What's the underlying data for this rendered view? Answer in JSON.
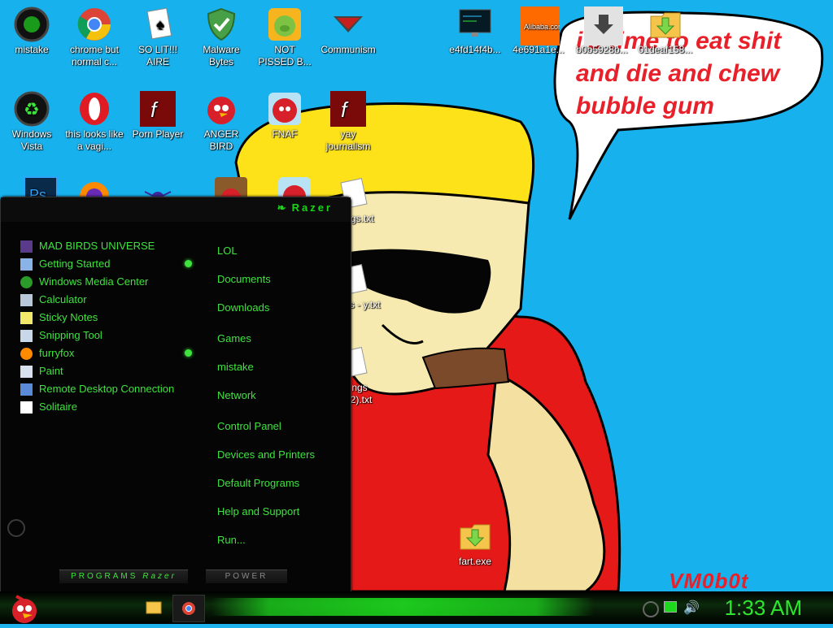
{
  "desktop": {
    "icons": [
      {
        "label": "mistake",
        "icon": "razer-black-icon"
      },
      {
        "label": "chrome but normal c...",
        "icon": "chrome-icon"
      },
      {
        "label": "SO LIT!!! AIRE",
        "icon": "playing-card-icon"
      },
      {
        "label": "Malware Bytes",
        "icon": "shield-check-icon"
      },
      {
        "label": "NOT PISSED B...",
        "icon": "angry-pig-icon"
      },
      {
        "label": "Communism",
        "icon": "red-emblem-icon"
      },
      {
        "label": "e4fd14f4b...",
        "icon": "terminal-screenshot-icon"
      },
      {
        "label": "4e691a1e...",
        "icon": "alibaba-icon"
      },
      {
        "label": "b0b5928b...",
        "icon": "download-icon"
      },
      {
        "label": "01deaf158...",
        "icon": "folder-download-icon"
      },
      {
        "label": "Windows Vista",
        "icon": "recycle-bin-icon"
      },
      {
        "label": "this looks like a vagi...",
        "icon": "opera-icon"
      },
      {
        "label": "Porn Player",
        "icon": "flash-icon"
      },
      {
        "label": "ANGER BIRD",
        "icon": "angry-bird-icon"
      },
      {
        "label": "FNAF",
        "icon": "angry-bird-icon"
      },
      {
        "label": "yay journalism",
        "icon": "flash-icon"
      },
      {
        "label": "fart.exe",
        "icon": "folder-download-icon"
      }
    ],
    "partial_labels": [
      "ngs.txt",
      "ngs - y.txt",
      "ngs (2).txt"
    ],
    "speech_bubble": [
      "i's time to eat shit",
      "and die and chew",
      "bubble gum"
    ],
    "signature": "VM0b0t"
  },
  "start_menu": {
    "brand": "Razer",
    "programs": [
      {
        "label": "MAD BIRDS UNIVERSE",
        "icon": "game-icon",
        "has_submenu": false
      },
      {
        "label": "Getting Started",
        "icon": "getting-started-icon",
        "has_submenu": true
      },
      {
        "label": "Windows Media Center",
        "icon": "media-center-icon",
        "has_submenu": false
      },
      {
        "label": "Calculator",
        "icon": "calculator-icon",
        "has_submenu": false
      },
      {
        "label": "Sticky Notes",
        "icon": "sticky-notes-icon",
        "has_submenu": false
      },
      {
        "label": "Snipping Tool",
        "icon": "scissors-icon",
        "has_submenu": false
      },
      {
        "label": "furryfox",
        "icon": "firefox-icon",
        "has_submenu": true
      },
      {
        "label": "Paint",
        "icon": "paint-icon",
        "has_submenu": false
      },
      {
        "label": "Remote Desktop Connection",
        "icon": "remote-desktop-icon",
        "has_submenu": false
      },
      {
        "label": "Solitaire",
        "icon": "solitaire-icon",
        "has_submenu": false
      }
    ],
    "places": [
      "LOL",
      "Documents",
      "Downloads",
      "Games",
      "mistake",
      "Network",
      "Control Panel",
      "Devices and Printers",
      "Default Programs",
      "Help and Support",
      "Run..."
    ],
    "programs_button": "PROGRAMS",
    "power_button": "POWER"
  },
  "taskbar": {
    "clock": "1:33 AM",
    "pinned": [
      "explorer-icon",
      "chrome-icon"
    ]
  },
  "colors": {
    "accent": "#3ee33e",
    "desktop_bg": "#17b2ee",
    "speech_text": "#e8202a"
  }
}
